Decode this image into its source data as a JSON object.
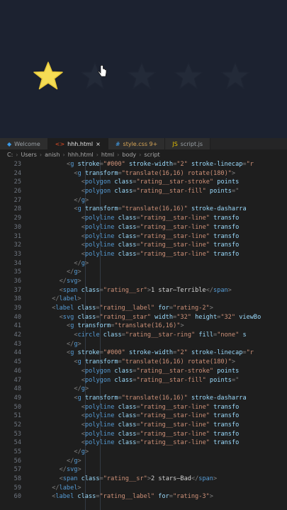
{
  "preview": {
    "star_count": 5,
    "active_star_count": 1,
    "colors": {
      "active": "#f5dd55",
      "inactive": "#232a38",
      "background": "#1c2230"
    }
  },
  "editor": {
    "tabs": [
      {
        "icon": "vscode-icon",
        "label": "Welcome",
        "state": "normal"
      },
      {
        "icon": "html-file-icon",
        "label": "hhh.html",
        "state": "active",
        "close": "×"
      },
      {
        "icon": "css-file-icon",
        "label": "style.css 9+",
        "state": "modified"
      },
      {
        "icon": "js-file-icon",
        "label": "script.js",
        "state": "normal"
      }
    ],
    "breadcrumb": [
      "C:",
      "Users",
      "anish",
      "hhh.html",
      "html",
      "body",
      "script"
    ],
    "lines": [
      {
        "n": "23",
        "indent": 10,
        "tokens": [
          [
            "p",
            "<"
          ],
          [
            "t",
            "g"
          ],
          [
            "a",
            " stroke"
          ],
          [
            "p",
            "="
          ],
          [
            "s",
            "\"#000\""
          ],
          [
            "a",
            " stroke-width"
          ],
          [
            "p",
            "="
          ],
          [
            "s",
            "\"2\""
          ],
          [
            "a",
            " stroke-linecap"
          ],
          [
            "p",
            "="
          ],
          [
            "s",
            "\"r"
          ]
        ]
      },
      {
        "n": "24",
        "indent": 12,
        "tokens": [
          [
            "p",
            "<"
          ],
          [
            "t",
            "g"
          ],
          [
            "a",
            " transform"
          ],
          [
            "p",
            "="
          ],
          [
            "s",
            "\"translate(16,16) rotate(180)\""
          ],
          [
            "p",
            ">"
          ]
        ]
      },
      {
        "n": "25",
        "indent": 14,
        "tokens": [
          [
            "p",
            "<"
          ],
          [
            "t",
            "polygon"
          ],
          [
            "a",
            " class"
          ],
          [
            "p",
            "="
          ],
          [
            "s",
            "\"rating__star-stroke\""
          ],
          [
            "a",
            " points"
          ]
        ]
      },
      {
        "n": "26",
        "indent": 14,
        "tokens": [
          [
            "p",
            "<"
          ],
          [
            "t",
            "polygon"
          ],
          [
            "a",
            " class"
          ],
          [
            "p",
            "="
          ],
          [
            "s",
            "\"rating__star-fill\""
          ],
          [
            "a",
            " points"
          ],
          [
            "p",
            "=\""
          ]
        ]
      },
      {
        "n": "27",
        "indent": 12,
        "tokens": [
          [
            "p",
            "</"
          ],
          [
            "t",
            "g"
          ],
          [
            "p",
            ">"
          ]
        ]
      },
      {
        "n": "28",
        "indent": 12,
        "tokens": [
          [
            "p",
            "<"
          ],
          [
            "t",
            "g"
          ],
          [
            "a",
            " transform"
          ],
          [
            "p",
            "="
          ],
          [
            "s",
            "\"translate(16,16)\""
          ],
          [
            "a",
            " stroke-dasharra"
          ]
        ]
      },
      {
        "n": "29",
        "indent": 14,
        "tokens": [
          [
            "p",
            "<"
          ],
          [
            "t",
            "polyline"
          ],
          [
            "a",
            " class"
          ],
          [
            "p",
            "="
          ],
          [
            "s",
            "\"rating__star-line\""
          ],
          [
            "a",
            " transfo"
          ]
        ]
      },
      {
        "n": "30",
        "indent": 14,
        "tokens": [
          [
            "p",
            "<"
          ],
          [
            "t",
            "polyline"
          ],
          [
            "a",
            " class"
          ],
          [
            "p",
            "="
          ],
          [
            "s",
            "\"rating__star-line\""
          ],
          [
            "a",
            " transfo"
          ]
        ]
      },
      {
        "n": "31",
        "indent": 14,
        "tokens": [
          [
            "p",
            "<"
          ],
          [
            "t",
            "polyline"
          ],
          [
            "a",
            " class"
          ],
          [
            "p",
            "="
          ],
          [
            "s",
            "\"rating__star-line\""
          ],
          [
            "a",
            " transfo"
          ]
        ]
      },
      {
        "n": "32",
        "indent": 14,
        "tokens": [
          [
            "p",
            "<"
          ],
          [
            "t",
            "polyline"
          ],
          [
            "a",
            " class"
          ],
          [
            "p",
            "="
          ],
          [
            "s",
            "\"rating__star-line\""
          ],
          [
            "a",
            " transfo"
          ]
        ]
      },
      {
        "n": "33",
        "indent": 14,
        "tokens": [
          [
            "p",
            "<"
          ],
          [
            "t",
            "polyline"
          ],
          [
            "a",
            " class"
          ],
          [
            "p",
            "="
          ],
          [
            "s",
            "\"rating__star-line\""
          ],
          [
            "a",
            " transfo"
          ]
        ]
      },
      {
        "n": "34",
        "indent": 12,
        "tokens": [
          [
            "p",
            "</"
          ],
          [
            "t",
            "g"
          ],
          [
            "p",
            ">"
          ]
        ]
      },
      {
        "n": "35",
        "indent": 10,
        "tokens": [
          [
            "p",
            "</"
          ],
          [
            "t",
            "g"
          ],
          [
            "p",
            ">"
          ]
        ]
      },
      {
        "n": "36",
        "indent": 8,
        "tokens": [
          [
            "p",
            "</"
          ],
          [
            "t",
            "svg"
          ],
          [
            "p",
            ">"
          ]
        ]
      },
      {
        "n": "37",
        "indent": 8,
        "tokens": [
          [
            "p",
            "<"
          ],
          [
            "t",
            "span"
          ],
          [
            "a",
            " class"
          ],
          [
            "p",
            "="
          ],
          [
            "s",
            "\"rating__sr\""
          ],
          [
            "p",
            ">"
          ],
          [
            "x",
            "1 star—Terrible"
          ],
          [
            "p",
            "</"
          ],
          [
            "t",
            "span"
          ],
          [
            "p",
            ">"
          ]
        ]
      },
      {
        "n": "38",
        "indent": 6,
        "tokens": [
          [
            "p",
            "</"
          ],
          [
            "t",
            "label"
          ],
          [
            "p",
            ">"
          ]
        ]
      },
      {
        "n": "39",
        "indent": 6,
        "tokens": [
          [
            "p",
            "<"
          ],
          [
            "t",
            "label"
          ],
          [
            "a",
            " class"
          ],
          [
            "p",
            "="
          ],
          [
            "s",
            "\"rating__label\""
          ],
          [
            "a",
            " for"
          ],
          [
            "p",
            "="
          ],
          [
            "s",
            "\"rating-2\""
          ],
          [
            "p",
            ">"
          ]
        ]
      },
      {
        "n": "40",
        "indent": 8,
        "tokens": [
          [
            "p",
            "<"
          ],
          [
            "t",
            "svg"
          ],
          [
            "a",
            " class"
          ],
          [
            "p",
            "="
          ],
          [
            "s",
            "\"rating__star\""
          ],
          [
            "a",
            " width"
          ],
          [
            "p",
            "="
          ],
          [
            "s",
            "\"32\""
          ],
          [
            "a",
            " height"
          ],
          [
            "p",
            "="
          ],
          [
            "s",
            "\"32\""
          ],
          [
            "a",
            " viewBo"
          ]
        ]
      },
      {
        "n": "41",
        "indent": 10,
        "tokens": [
          [
            "p",
            "<"
          ],
          [
            "t",
            "g"
          ],
          [
            "a",
            " transform"
          ],
          [
            "p",
            "="
          ],
          [
            "s",
            "\"translate(16,16)\""
          ],
          [
            "p",
            ">"
          ]
        ]
      },
      {
        "n": "42",
        "indent": 12,
        "tokens": [
          [
            "p",
            "<"
          ],
          [
            "t",
            "circle"
          ],
          [
            "a",
            " class"
          ],
          [
            "p",
            "="
          ],
          [
            "s",
            "\"rating__star-ring\""
          ],
          [
            "a",
            " fill"
          ],
          [
            "p",
            "="
          ],
          [
            "s",
            "\"none\""
          ],
          [
            "a",
            " s"
          ]
        ]
      },
      {
        "n": "43",
        "indent": 10,
        "tokens": [
          [
            "p",
            "</"
          ],
          [
            "t",
            "g"
          ],
          [
            "p",
            ">"
          ]
        ]
      },
      {
        "n": "44",
        "indent": 10,
        "tokens": [
          [
            "p",
            "<"
          ],
          [
            "t",
            "g"
          ],
          [
            "a",
            " stroke"
          ],
          [
            "p",
            "="
          ],
          [
            "s",
            "\"#000\""
          ],
          [
            "a",
            " stroke-width"
          ],
          [
            "p",
            "="
          ],
          [
            "s",
            "\"2\""
          ],
          [
            "a",
            " stroke-linecap"
          ],
          [
            "p",
            "="
          ],
          [
            "s",
            "\"r"
          ]
        ]
      },
      {
        "n": "45",
        "indent": 12,
        "tokens": [
          [
            "p",
            "<"
          ],
          [
            "t",
            "g"
          ],
          [
            "a",
            " transform"
          ],
          [
            "p",
            "="
          ],
          [
            "s",
            "\"translate(16,16) rotate(180)\""
          ],
          [
            "p",
            ">"
          ]
        ]
      },
      {
        "n": "46",
        "indent": 14,
        "tokens": [
          [
            "p",
            "<"
          ],
          [
            "t",
            "polygon"
          ],
          [
            "a",
            " class"
          ],
          [
            "p",
            "="
          ],
          [
            "s",
            "\"rating__star-stroke\""
          ],
          [
            "a",
            " points"
          ]
        ]
      },
      {
        "n": "47",
        "indent": 14,
        "tokens": [
          [
            "p",
            "<"
          ],
          [
            "t",
            "polygon"
          ],
          [
            "a",
            " class"
          ],
          [
            "p",
            "="
          ],
          [
            "s",
            "\"rating__star-fill\""
          ],
          [
            "a",
            " points"
          ],
          [
            "p",
            "=\""
          ]
        ]
      },
      {
        "n": "48",
        "indent": 12,
        "tokens": [
          [
            "p",
            "</"
          ],
          [
            "t",
            "g"
          ],
          [
            "p",
            ">"
          ]
        ]
      },
      {
        "n": "49",
        "indent": 12,
        "tokens": [
          [
            "p",
            "<"
          ],
          [
            "t",
            "g"
          ],
          [
            "a",
            " transform"
          ],
          [
            "p",
            "="
          ],
          [
            "s",
            "\"translate(16,16)\""
          ],
          [
            "a",
            " stroke-dasharra"
          ]
        ]
      },
      {
        "n": "50",
        "indent": 14,
        "tokens": [
          [
            "p",
            "<"
          ],
          [
            "t",
            "polyline"
          ],
          [
            "a",
            " class"
          ],
          [
            "p",
            "="
          ],
          [
            "s",
            "\"rating__star-line\""
          ],
          [
            "a",
            " transfo"
          ]
        ]
      },
      {
        "n": "51",
        "indent": 14,
        "tokens": [
          [
            "p",
            "<"
          ],
          [
            "t",
            "polyline"
          ],
          [
            "a",
            " class"
          ],
          [
            "p",
            "="
          ],
          [
            "s",
            "\"rating__star-line\""
          ],
          [
            "a",
            " transfo"
          ]
        ]
      },
      {
        "n": "52",
        "indent": 14,
        "tokens": [
          [
            "p",
            "<"
          ],
          [
            "t",
            "polyline"
          ],
          [
            "a",
            " class"
          ],
          [
            "p",
            "="
          ],
          [
            "s",
            "\"rating__star-line\""
          ],
          [
            "a",
            " transfo"
          ]
        ]
      },
      {
        "n": "53",
        "indent": 14,
        "tokens": [
          [
            "p",
            "<"
          ],
          [
            "t",
            "polyline"
          ],
          [
            "a",
            " class"
          ],
          [
            "p",
            "="
          ],
          [
            "s",
            "\"rating__star-line\""
          ],
          [
            "a",
            " transfo"
          ]
        ]
      },
      {
        "n": "54",
        "indent": 14,
        "tokens": [
          [
            "p",
            "<"
          ],
          [
            "t",
            "polyline"
          ],
          [
            "a",
            " class"
          ],
          [
            "p",
            "="
          ],
          [
            "s",
            "\"rating__star-line\""
          ],
          [
            "a",
            " transfo"
          ]
        ]
      },
      {
        "n": "55",
        "indent": 12,
        "tokens": [
          [
            "p",
            "</"
          ],
          [
            "t",
            "g"
          ],
          [
            "p",
            ">"
          ]
        ]
      },
      {
        "n": "56",
        "indent": 10,
        "tokens": [
          [
            "p",
            "</"
          ],
          [
            "t",
            "g"
          ],
          [
            "p",
            ">"
          ]
        ]
      },
      {
        "n": "57",
        "indent": 8,
        "tokens": [
          [
            "p",
            "</"
          ],
          [
            "t",
            "svg"
          ],
          [
            "p",
            ">"
          ]
        ]
      },
      {
        "n": "58",
        "indent": 8,
        "tokens": [
          [
            "p",
            "<"
          ],
          [
            "t",
            "span"
          ],
          [
            "a",
            " class"
          ],
          [
            "p",
            "="
          ],
          [
            "s",
            "\"rating__sr\""
          ],
          [
            "p",
            ">"
          ],
          [
            "x",
            "2 stars—Bad"
          ],
          [
            "p",
            "</"
          ],
          [
            "t",
            "span"
          ],
          [
            "p",
            ">"
          ]
        ]
      },
      {
        "n": "59",
        "indent": 6,
        "tokens": [
          [
            "p",
            "</"
          ],
          [
            "t",
            "label"
          ],
          [
            "p",
            ">"
          ]
        ]
      },
      {
        "n": "60",
        "indent": 6,
        "tokens": [
          [
            "p",
            "<"
          ],
          [
            "t",
            "label"
          ],
          [
            "a",
            " class"
          ],
          [
            "p",
            "="
          ],
          [
            "s",
            "\"rating__label\""
          ],
          [
            "a",
            " for"
          ],
          [
            "p",
            "="
          ],
          [
            "s",
            "\"rating-3\""
          ],
          [
            "p",
            ">"
          ]
        ]
      }
    ]
  }
}
